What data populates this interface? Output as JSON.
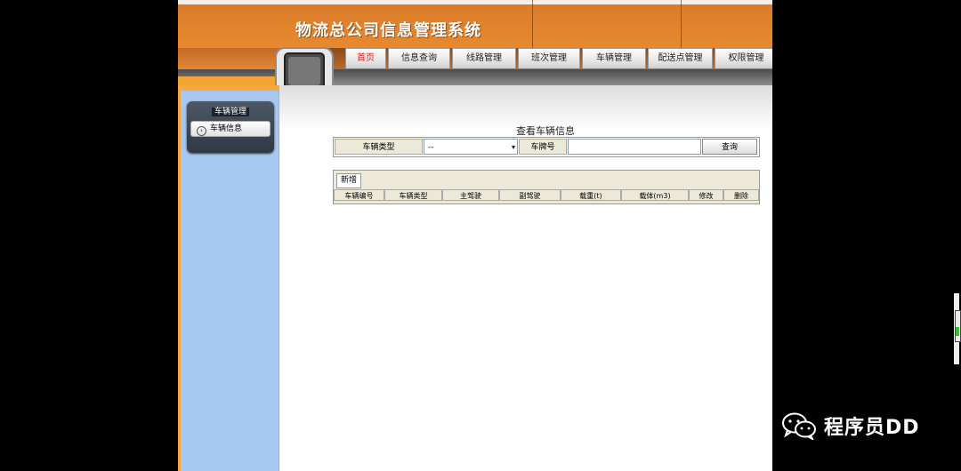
{
  "header": {
    "site_title": "物流总公司信息管理系统",
    "tabs": [
      {
        "label": "首页",
        "active": true
      },
      {
        "label": "信息查询",
        "active": false
      },
      {
        "label": "线路管理",
        "active": false
      },
      {
        "label": "班次管理",
        "active": false
      },
      {
        "label": "车辆管理",
        "active": false
      },
      {
        "label": "配送点管理",
        "active": false
      },
      {
        "label": "权限管理",
        "active": false
      }
    ]
  },
  "sidebar": {
    "menu_title": "车辆管理",
    "items": [
      {
        "label": "车辆信息",
        "icon": "circle-arrow-right-icon"
      }
    ]
  },
  "main": {
    "heading": "查看车辆信息",
    "search": {
      "type_label": "车辆类型",
      "type_value": "--",
      "plate_label": "车牌号",
      "plate_value": "",
      "query_button": "查询"
    },
    "add_button": "新增",
    "columns": [
      "车辆编号",
      "车辆类型",
      "主驾驶",
      "副驾驶",
      "载重(t)",
      "载体(m3)",
      "修改",
      "删除"
    ]
  },
  "watermark": {
    "text": "程序员DD",
    "icon": "wechat-icon"
  },
  "colors": {
    "header_orange": "#e08530",
    "sidebar_orange": "#f7a83c",
    "sidebar_blue": "#a6c8f0",
    "active_tab": "#e21a1a"
  }
}
